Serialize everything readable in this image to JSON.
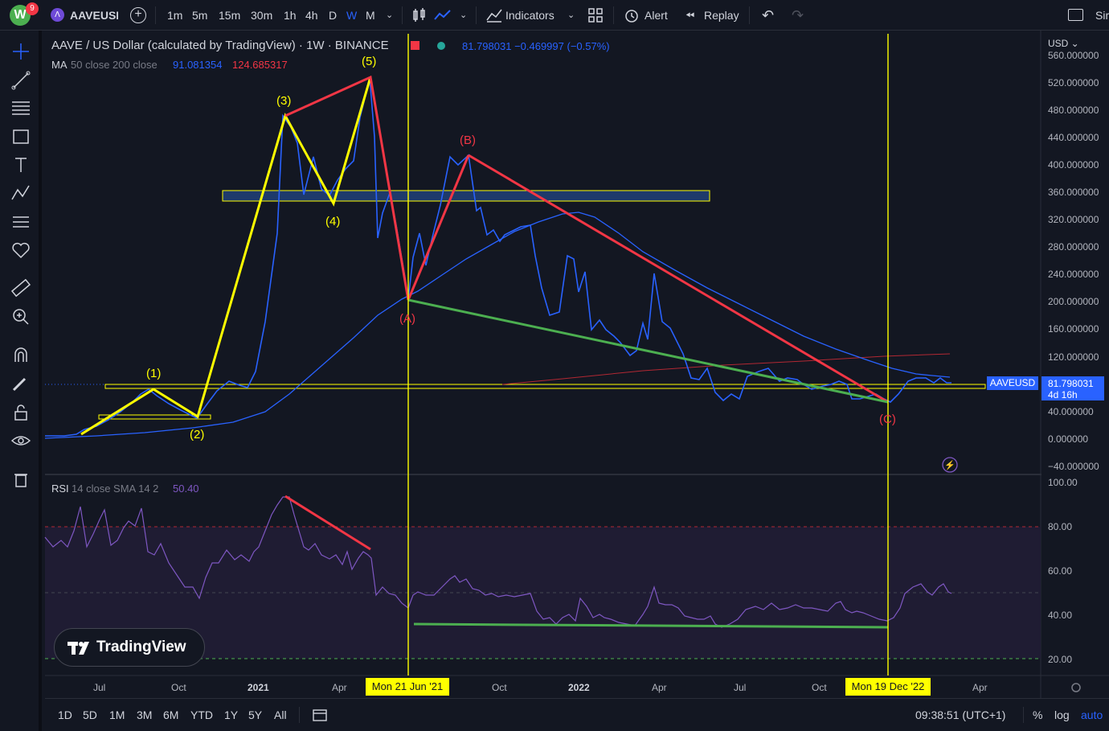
{
  "header": {
    "notification_count": "9",
    "symbol": "AAVEUSI",
    "intervals": [
      "1m",
      "5m",
      "15m",
      "30m",
      "1h",
      "4h",
      "D",
      "W",
      "M"
    ],
    "active_interval": "W",
    "indicators_label": "Indicators",
    "alert_label": "Alert",
    "replay_label": "Replay",
    "cut_label": "Sir"
  },
  "legend": {
    "title": "AAVE / US Dollar (calculated by TradingView) · 1W · BINANCE",
    "price_values": "81.798031  −0.469997 (−0.57%)",
    "ma_label": "MA",
    "ma_params": "50 close 200 close",
    "ma_value_1": "91.081354",
    "ma_value_2": "124.685317",
    "rsi_label": "RSI",
    "rsi_params": "14 close SMA 14 2",
    "rsi_value": "50.40"
  },
  "price_axis": {
    "currency": "USD",
    "ticks": [
      "560.000000",
      "520.000000",
      "480.000000",
      "440.000000",
      "400.000000",
      "360.000000",
      "320.000000",
      "280.000000",
      "240.000000",
      "200.000000",
      "160.000000",
      "120.000000",
      "40.000000",
      "0.000000",
      "−40.000000"
    ],
    "symbol_badge": "AAVEUSD",
    "last_price": "81.798031",
    "countdown": "4d 16h"
  },
  "rsi_axis": {
    "ticks": [
      "100.00",
      "80.00",
      "60.00",
      "40.00",
      "20.00"
    ]
  },
  "time_axis": {
    "ticks": [
      "Jul",
      "Oct",
      "2021",
      "Apr",
      "Oct",
      "2022",
      "Apr",
      "Jul",
      "Oct",
      "Apr"
    ],
    "crosshair_1": "Mon 21 Jun '21",
    "crosshair_2": "Mon 19 Dec '22"
  },
  "wave_labels": [
    "(1)",
    "(2)",
    "(3)",
    "(4)",
    "(5)",
    "(A)",
    "(B)",
    "(C)"
  ],
  "bottom_bar": {
    "ranges": [
      "1D",
      "5D",
      "1M",
      "3M",
      "6M",
      "YTD",
      "1Y",
      "5Y",
      "All"
    ],
    "clock": "09:38:51 (UTC+1)",
    "percent_label": "%",
    "log_label": "log",
    "auto_label": "auto"
  },
  "watermark": "TradingView",
  "colors": {
    "price_line": "#2962ff",
    "ma50": "#2962ff",
    "ma200": "#b22833",
    "impulse": "#ffff00",
    "correction": "#f23645",
    "support": "#4caf50",
    "rsi_line": "#7e57c2",
    "background": "#131722"
  },
  "chart_data": {
    "type": "line",
    "title": "AAVE / US Dollar (calculated by TradingView) · 1W · BINANCE",
    "y_scale": "linear",
    "ylim": [
      -40,
      560
    ],
    "rsi_ylim": [
      20,
      100
    ],
    "series": [
      {
        "name": "AAVEUSD",
        "values": [
          10,
          10,
          12,
          15,
          30,
          35,
          45,
          60,
          80,
          70,
          55,
          50,
          45,
          40,
          35,
          50,
          60,
          80,
          75,
          80,
          120,
          200,
          280,
          480,
          440,
          380,
          360,
          420,
          440,
          510,
          520,
          480,
          320,
          300,
          380,
          200,
          260,
          340,
          310,
          400,
          420,
          410,
          380,
          320,
          300,
          280,
          300,
          250,
          230,
          280,
          180,
          190,
          280,
          170,
          150,
          240,
          200,
          230,
          170,
          130,
          90,
          60,
          65,
          80,
          90,
          85,
          70,
          60,
          65,
          75,
          70,
          85,
          80,
          70,
          55,
          50,
          60,
          80,
          90,
          85,
          80
        ]
      },
      {
        "name": "MA 50",
        "values": [
          5,
          5,
          8,
          10,
          12,
          15,
          18,
          20,
          25,
          30,
          35,
          40,
          45,
          50,
          60,
          80,
          110,
          140,
          170,
          200,
          230,
          250,
          270,
          285,
          300,
          310,
          320,
          325,
          330,
          330,
          325,
          320,
          310,
          300,
          285,
          270,
          250,
          230,
          210,
          190,
          170,
          150,
          135,
          120,
          110,
          100,
          95,
          90,
          91
        ]
      },
      {
        "name": "MA 200",
        "values": [
          75,
          80,
          90,
          100,
          110,
          115,
          120,
          124
        ]
      },
      {
        "name": "RSI",
        "values": [
          80,
          75,
          85,
          90,
          75,
          80,
          82,
          90,
          70,
          60,
          50,
          65,
          75,
          80,
          94,
          85,
          80,
          75,
          70,
          50,
          45,
          50,
          55,
          52,
          50,
          48,
          45,
          40,
          45,
          42,
          40,
          38,
          55,
          42,
          40,
          38,
          35,
          45,
          40,
          38,
          42,
          45,
          40,
          38,
          36,
          40,
          50,
          55,
          50
        ]
      }
    ],
    "annotations": {
      "wave_points": [
        "(1)",
        "(2)",
        "(3)",
        "(4)",
        "(5)",
        "(A)",
        "(B)",
        "(C)"
      ],
      "zones": [
        "resistance box ~350-370",
        "support line ~80"
      ]
    },
    "grid": false,
    "legend_position": "top-left"
  }
}
